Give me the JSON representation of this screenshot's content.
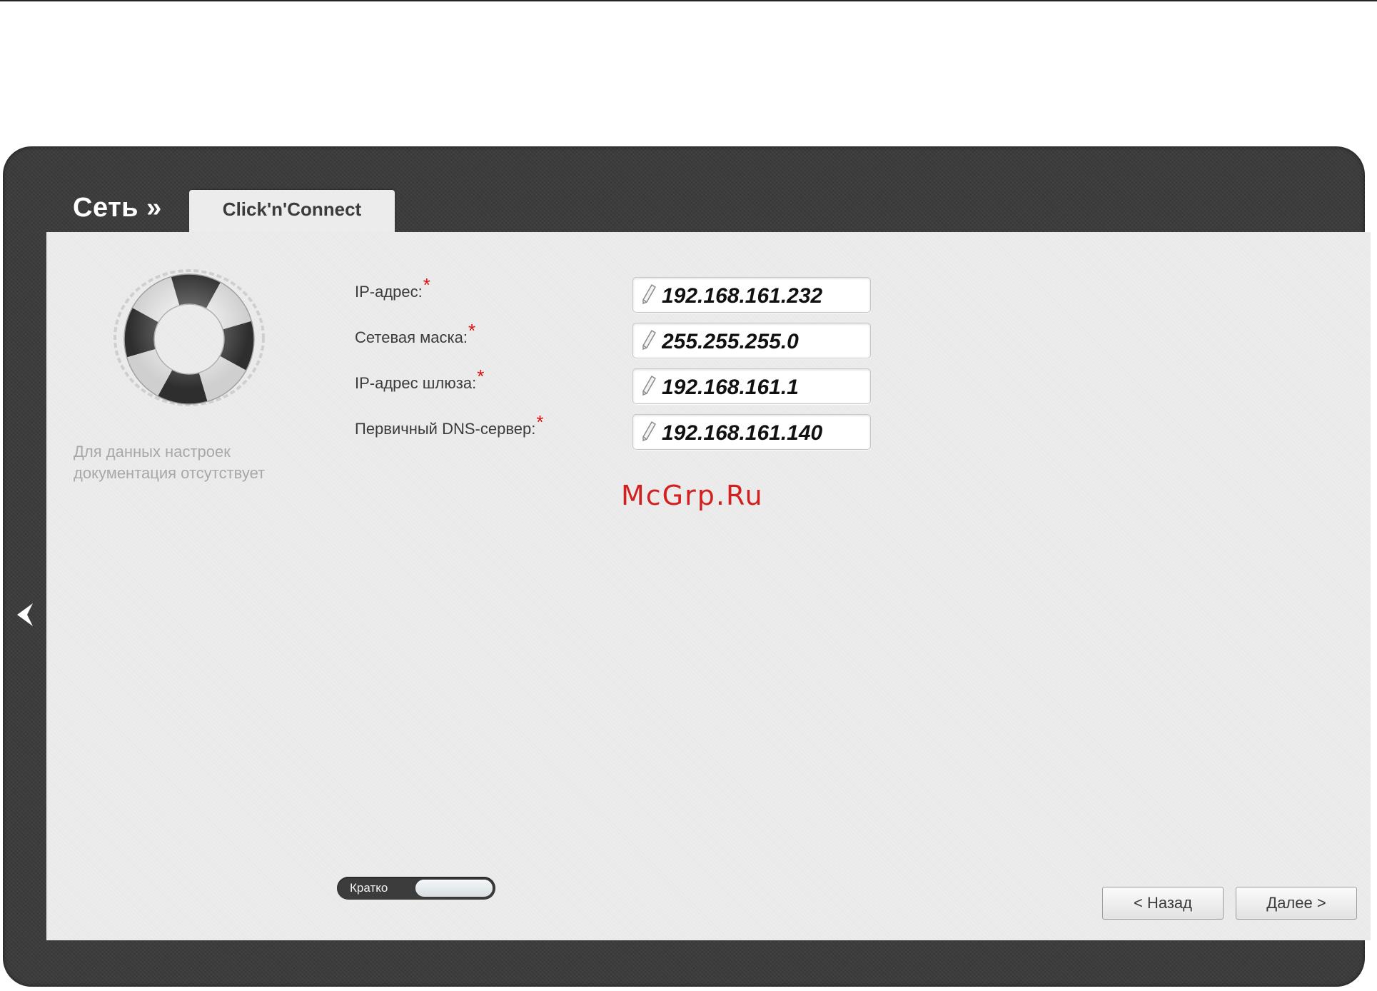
{
  "header": {
    "breadcrumb": "Сеть »",
    "tab_label": "Click'n'Connect"
  },
  "sidebar": {
    "help_text": "Для данных настроек документация отсутствует"
  },
  "form": {
    "required_mark": "*",
    "fields": [
      {
        "label": "IP-адрес:",
        "value": "192.168.161.232"
      },
      {
        "label": "Сетевая маска:",
        "value": "255.255.255.0"
      },
      {
        "label": "IP-адрес шлюза:",
        "value": "192.168.161.1"
      },
      {
        "label": "Первичный DNS-сервер:",
        "value": "192.168.161.140"
      }
    ]
  },
  "watermark": "McGrp.Ru",
  "footer": {
    "mode_toggle_label": "Кратко",
    "back_button": "< Назад",
    "next_button": "Далее >"
  },
  "colors": {
    "frame": "#3a3a3a",
    "panel": "#ececec",
    "required": "#e01010",
    "watermark": "#d22020"
  },
  "icons": {
    "collapse": "chevron-left-icon",
    "help": "lifebuoy-icon",
    "edit": "pencil-icon"
  }
}
